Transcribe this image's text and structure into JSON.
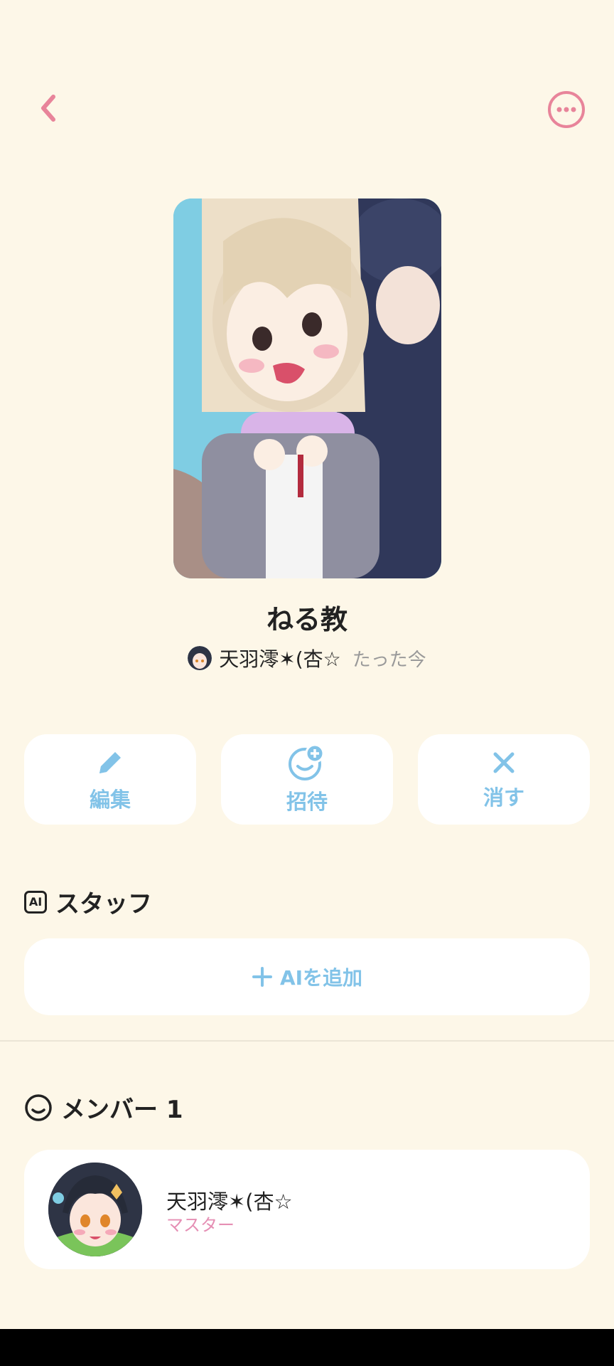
{
  "header": {
    "back_icon": "chevron-left-icon",
    "more_icon": "more-horizontal-icon",
    "accent_color": "#e8849a"
  },
  "group": {
    "title": "ねる教",
    "creator_name": "天羽澪✶(杏☆",
    "timestamp": "たった今"
  },
  "actions": [
    {
      "label": "編集",
      "icon": "pencil-icon"
    },
    {
      "label": "招待",
      "icon": "add-friend-icon"
    },
    {
      "label": "消す",
      "icon": "close-icon"
    }
  ],
  "ai_section": {
    "title": "スタッフ",
    "badge": "AI",
    "add_label": "AIを追加"
  },
  "members_section": {
    "title": "メンバー 1",
    "members": [
      {
        "name": "天羽澪✶(杏☆",
        "role": "マスター"
      }
    ]
  },
  "colors": {
    "background": "#fdf7e8",
    "action_blue": "#82c3e8",
    "role_pink": "#e58fb4"
  }
}
